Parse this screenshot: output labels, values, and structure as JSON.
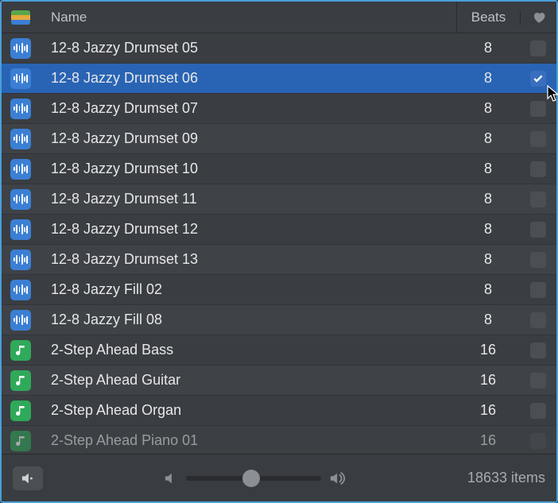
{
  "columns": {
    "name": "Name",
    "beats": "Beats"
  },
  "rows": [
    {
      "type": "audio",
      "name": "12-8 Jazzy Drumset 05",
      "beats": "8",
      "fav": false,
      "selected": false
    },
    {
      "type": "audio",
      "name": "12-8 Jazzy Drumset 06",
      "beats": "8",
      "fav": true,
      "selected": true
    },
    {
      "type": "audio",
      "name": "12-8 Jazzy Drumset 07",
      "beats": "8",
      "fav": false,
      "selected": false
    },
    {
      "type": "audio",
      "name": "12-8 Jazzy Drumset 09",
      "beats": "8",
      "fav": false,
      "selected": false
    },
    {
      "type": "audio",
      "name": "12-8 Jazzy Drumset 10",
      "beats": "8",
      "fav": false,
      "selected": false
    },
    {
      "type": "audio",
      "name": "12-8 Jazzy Drumset 11",
      "beats": "8",
      "fav": false,
      "selected": false
    },
    {
      "type": "audio",
      "name": "12-8 Jazzy Drumset 12",
      "beats": "8",
      "fav": false,
      "selected": false
    },
    {
      "type": "audio",
      "name": "12-8 Jazzy Drumset 13",
      "beats": "8",
      "fav": false,
      "selected": false
    },
    {
      "type": "audio",
      "name": "12-8 Jazzy Fill 02",
      "beats": "8",
      "fav": false,
      "selected": false
    },
    {
      "type": "audio",
      "name": "12-8 Jazzy Fill 08",
      "beats": "8",
      "fav": false,
      "selected": false
    },
    {
      "type": "midi",
      "name": "2-Step Ahead Bass",
      "beats": "16",
      "fav": false,
      "selected": false
    },
    {
      "type": "midi",
      "name": "2-Step Ahead Guitar",
      "beats": "16",
      "fav": false,
      "selected": false
    },
    {
      "type": "midi",
      "name": "2-Step Ahead Organ",
      "beats": "16",
      "fav": false,
      "selected": false
    },
    {
      "type": "midi",
      "name": "2-Step Ahead Piano 01",
      "beats": "16",
      "fav": false,
      "selected": false
    }
  ],
  "footer": {
    "items": "18633 items"
  }
}
